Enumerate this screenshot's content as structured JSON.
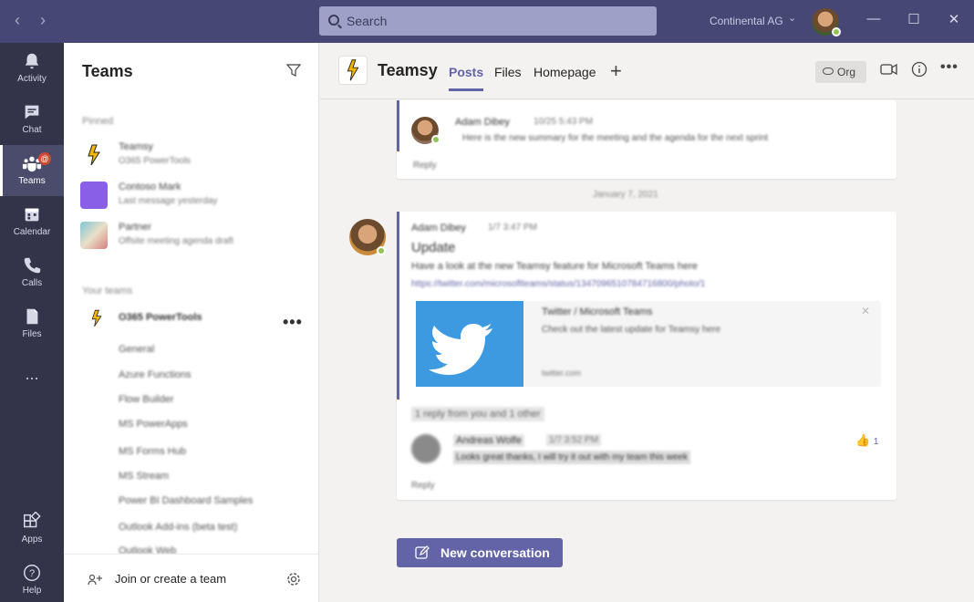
{
  "titlebar": {
    "back_icon": "chevron-left-icon",
    "forward_icon": "chevron-right-icon",
    "search_placeholder": "Search",
    "org_name": "Continental AG",
    "window_controls": [
      "minimize-icon",
      "maximize-icon",
      "close-icon"
    ]
  },
  "rail": {
    "items": [
      {
        "label": "Activity",
        "icon": "bell-icon"
      },
      {
        "label": "Chat",
        "icon": "chat-icon"
      },
      {
        "label": "Teams",
        "icon": "teams-icon",
        "active": true,
        "badge": "@"
      },
      {
        "label": "Calendar",
        "icon": "calendar-icon"
      },
      {
        "label": "Calls",
        "icon": "phone-icon"
      },
      {
        "label": "Files",
        "icon": "file-icon"
      }
    ],
    "more": "...",
    "bottom": [
      {
        "label": "Apps",
        "icon": "apps-icon"
      },
      {
        "label": "Help",
        "icon": "help-icon"
      }
    ]
  },
  "panel": {
    "title": "Teams",
    "filter_icon": "filter-icon",
    "section1": "Pinned",
    "pinned": [
      {
        "name": "Teamsy",
        "sub": "O365 PowerTools"
      },
      {
        "name": "Contoso Mark",
        "sub": "Last message yesterday"
      },
      {
        "name": "Partner",
        "sub": "Offsite meeting agenda draft"
      }
    ],
    "section2": "Your teams",
    "team": {
      "name": "O365 PowerTools"
    },
    "channels": [
      "General",
      "Azure Functions",
      "Flow Builder",
      "MS PowerApps",
      "MS Forms Hub",
      "MS Stream",
      "Power BI Dashboard Samples",
      "Outlook Add-ins (beta test)",
      "Outlook Web"
    ],
    "more_icon": "more-icon",
    "footer": {
      "join_label": "Join or create a team",
      "gear_icon": "gear-icon"
    }
  },
  "channel": {
    "name": "Teamsy",
    "tabs": [
      "Posts",
      "Files",
      "Homepage"
    ],
    "active_tab": "Posts",
    "add_tab": "+",
    "org_button": "Org"
  },
  "feed": {
    "post1": {
      "author": "Adam Dibey",
      "time": "10/25 5:43 PM",
      "text": "Here is the new summary for the meeting and the agenda for the next sprint"
    },
    "post1_reply": "Reply",
    "date_separator": "January 7, 2021",
    "post2": {
      "author": "Adam Dibey",
      "time": "1/7 3:47 PM",
      "title": "Update",
      "text": "Have a look at the new Teamsy feature for Microsoft Teams here",
      "link": "https://twitter.com/microsoftteams/status/1347096510784716800/photo/1"
    },
    "twitter_card": {
      "title": "Twitter / Microsoft Teams",
      "text": "Check out the latest update for Teamsy here",
      "meta": "twitter.com"
    },
    "replies_collapsed": "1 reply from you and 1 other",
    "reply": {
      "author": "Andreas Wolfe",
      "time": "1/7 3:52 PM",
      "text": "Looks great thanks, I will try it out with my team this week"
    },
    "like_count": "1",
    "post2_reply": "Reply",
    "new_conversation": "New conversation"
  }
}
